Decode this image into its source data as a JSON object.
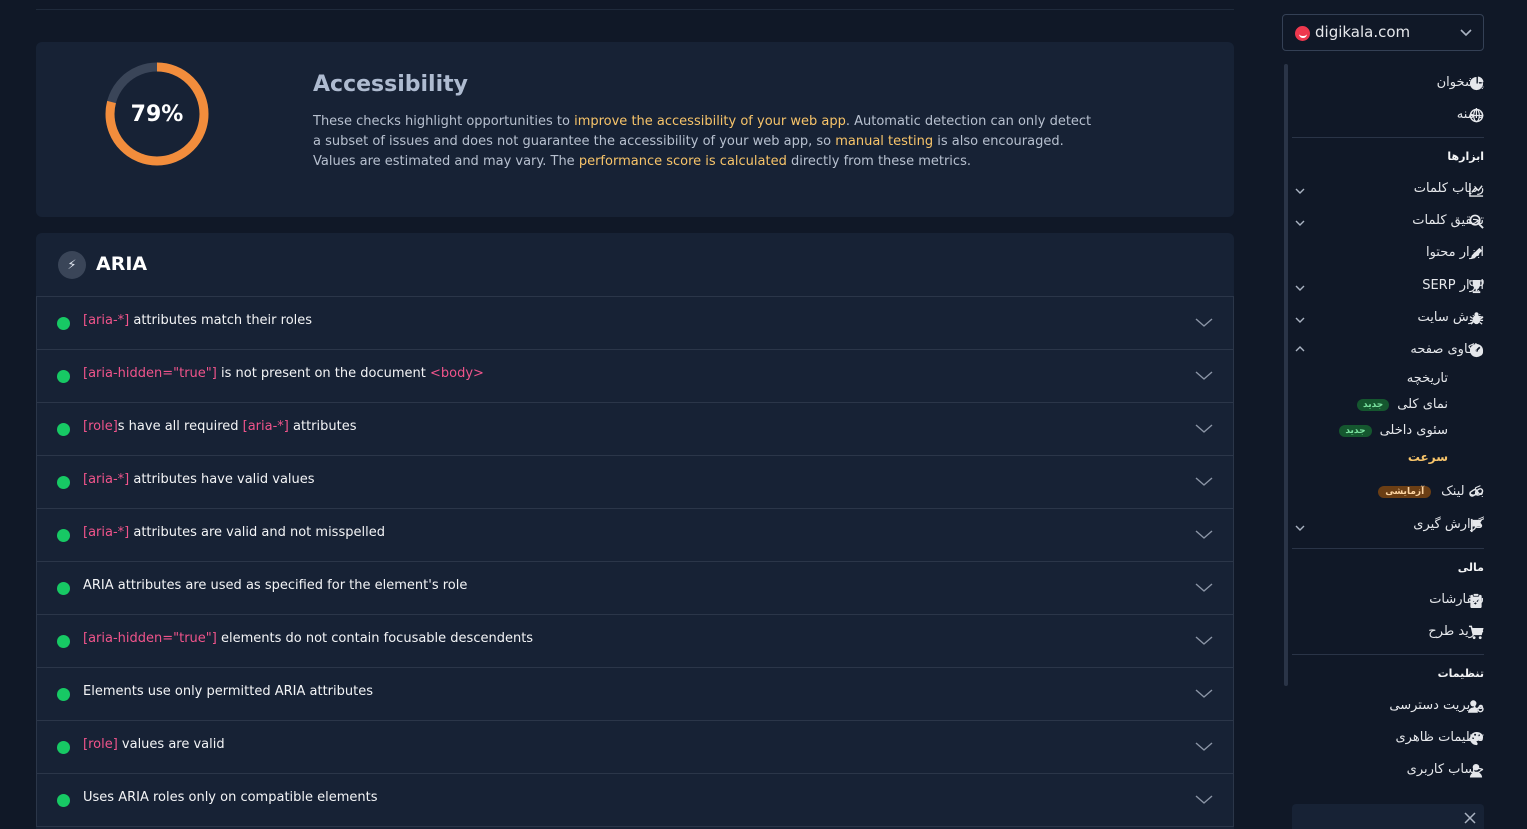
{
  "score": {
    "percent_label": "79%",
    "value": 0.79,
    "title": "Accessibility",
    "desc": {
      "p1": "These checks highlight opportunities to ",
      "h1": "improve the accessibility of your web app",
      "p2": ". Automatic detection can only detect a subset of issues and does not guarantee the accessibility of your web app, so ",
      "h2": "manual testing",
      "p3": " is also encouraged.",
      "p4": "Values are estimated and may vary. The ",
      "h3": "performance score is calculated",
      "p5": " directly from these metrics."
    },
    "colors": {
      "ring": "#f28d3c",
      "track": "#3a4558",
      "highlight": "#f7c46a"
    }
  },
  "aria": {
    "title": "ARIA",
    "icon": "bolt-icon",
    "audits": [
      {
        "code1": "[aria-*]",
        "text1": " attributes match their roles",
        "code2": "",
        "text2": "",
        "code3": "",
        "text3": ""
      },
      {
        "code1": "[aria-hidden=\"true\"]",
        "text1": " is not present on the document ",
        "code2": "<body>",
        "text2": "",
        "code3": "",
        "text3": ""
      },
      {
        "code1": "[role]",
        "text1": "s have all required ",
        "code2": "[aria-*]",
        "text2": " attributes",
        "code3": "",
        "text3": ""
      },
      {
        "code1": "[aria-*]",
        "text1": " attributes have valid values",
        "code2": "",
        "text2": "",
        "code3": "",
        "text3": ""
      },
      {
        "code1": "[aria-*]",
        "text1": " attributes are valid and not misspelled",
        "code2": "",
        "text2": "",
        "code3": "",
        "text3": ""
      },
      {
        "code1": "",
        "text1": "ARIA attributes are used as specified for the element's role",
        "code2": "",
        "text2": "",
        "code3": "",
        "text3": ""
      },
      {
        "code1": "[aria-hidden=\"true\"]",
        "text1": " elements do not contain focusable descendents",
        "code2": "",
        "text2": "",
        "code3": "",
        "text3": ""
      },
      {
        "code1": "",
        "text1": "Elements use only permitted ARIA attributes",
        "code2": "",
        "text2": "",
        "code3": "",
        "text3": ""
      },
      {
        "code1": "[role]",
        "text1": " values are valid",
        "code2": "",
        "text2": "",
        "code3": "",
        "text3": ""
      },
      {
        "code1": "",
        "text1": "Uses ARIA roles only on compatible elements",
        "code2": "",
        "text2": "",
        "code3": "",
        "text3": ""
      }
    ],
    "colors": {
      "pass": "#17c964",
      "code": "#f0548b"
    }
  },
  "sidebar": {
    "domain": "digikala.com",
    "items": {
      "dashboard": "پیشخوان",
      "domain": "دامنه",
      "tools_label": "ابزارها",
      "rank_tracker": "ردیاب کلمات",
      "keyword_research": "تحقیق کلمات",
      "content_tools": "ابزار محتوا",
      "serp_tools": "ابزار SERP",
      "site_crawl": "خزش سایت",
      "page_audit": "واکاوی صفحه",
      "history": "تاریخچه",
      "overview": "نمای کلی",
      "internal_level": "سئوی داخلی",
      "speed": "سرعت",
      "backlink": "بک لینک",
      "reporting": "گزارش گیری",
      "finance_label": "مالی",
      "orders": "سفارشات",
      "buy_plan": "خرید طرح",
      "settings_label": "تنظیمات",
      "access_management": "مدیریت دسترسی",
      "appearance": "تنظیمات ظاهری",
      "user_account": "حساب کاربری"
    },
    "badges": {
      "new": "جدید",
      "experimental": "آزمایشی"
    },
    "colors": {
      "active": "#f7c46a",
      "new_badge": "#15572f",
      "exp_badge": "#6b3e14"
    }
  }
}
